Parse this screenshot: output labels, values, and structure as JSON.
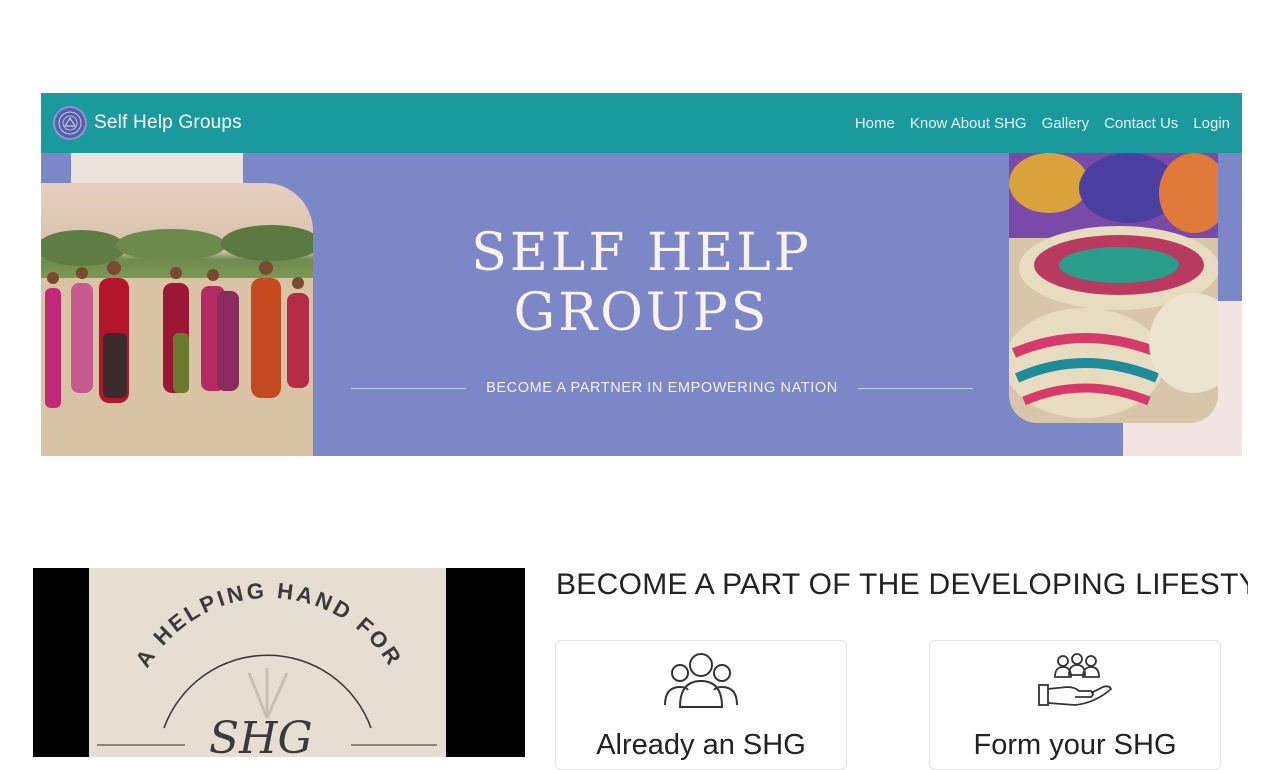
{
  "navbar": {
    "brand": "Self Help Groups",
    "logo_icon": "emblem-icon",
    "links": [
      "Home",
      "Know About SHG",
      "Gallery",
      "Contact Us",
      "Login"
    ]
  },
  "hero": {
    "title_line1": "SELF HELP",
    "title_line2": "GROUPS",
    "subtitle": "BECOME A PARTNER IN EMPOWERING NATION",
    "colors": {
      "banner": "#7b87c6",
      "accent_pink": "#f2e4e1",
      "navbar": "#1a9a9d"
    }
  },
  "promo": {
    "arc_text": "A HELPING HAND FOR",
    "logo_text": "SHG"
  },
  "section": {
    "heading": "BECOME A PART OF THE DEVELOPING LIFESTYLE",
    "cards": [
      {
        "label": "Already an SHG",
        "icon": "group-people-icon"
      },
      {
        "label": "Form your SHG",
        "icon": "hand-holding-people-icon"
      }
    ]
  }
}
